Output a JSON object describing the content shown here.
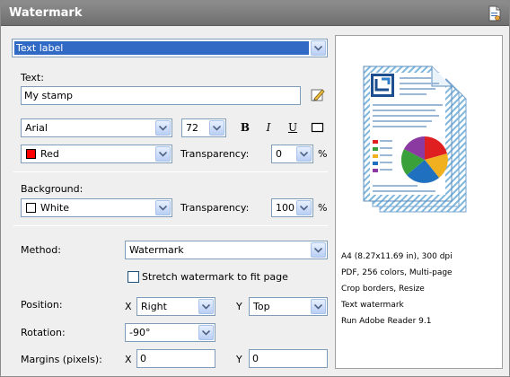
{
  "window": {
    "title": "Watermark"
  },
  "type_select": {
    "value": "Text label"
  },
  "text": {
    "label": "Text:",
    "value": "My stamp"
  },
  "font": {
    "family": "Arial",
    "size": "72",
    "bold": "B",
    "italic": "I",
    "underline": "U"
  },
  "color": {
    "value": "Red",
    "swatch": "#ff0000",
    "transparency_label": "Transparency:",
    "transparency": "0",
    "unit": "%"
  },
  "background": {
    "label": "Background:",
    "value": "White",
    "swatch": "#ffffff",
    "transparency_label": "Transparency:",
    "transparency": "100",
    "unit": "%"
  },
  "method": {
    "label": "Method:",
    "value": "Watermark",
    "stretch_label": "Stretch watermark to fit page"
  },
  "position": {
    "label": "Position:",
    "x_label": "X",
    "x_value": "Right",
    "y_label": "Y",
    "y_value": "Top"
  },
  "rotation": {
    "label": "Rotation:",
    "value": "-90°"
  },
  "margins": {
    "label": "Margins (pixels):",
    "x_label": "X",
    "x_value": "0",
    "y_label": "Y",
    "y_value": "0"
  },
  "preview_info": [
    "A4 (8.27x11.69 in), 300 dpi",
    "PDF, 256 colors, Multi-page",
    "Crop borders, Resize",
    "Text watermark",
    "Run Adobe Reader 9.1"
  ],
  "colors": {
    "accent_select": "#316ac5",
    "title_bar": "#7d7d7d",
    "field_border": "#7f9db9"
  }
}
